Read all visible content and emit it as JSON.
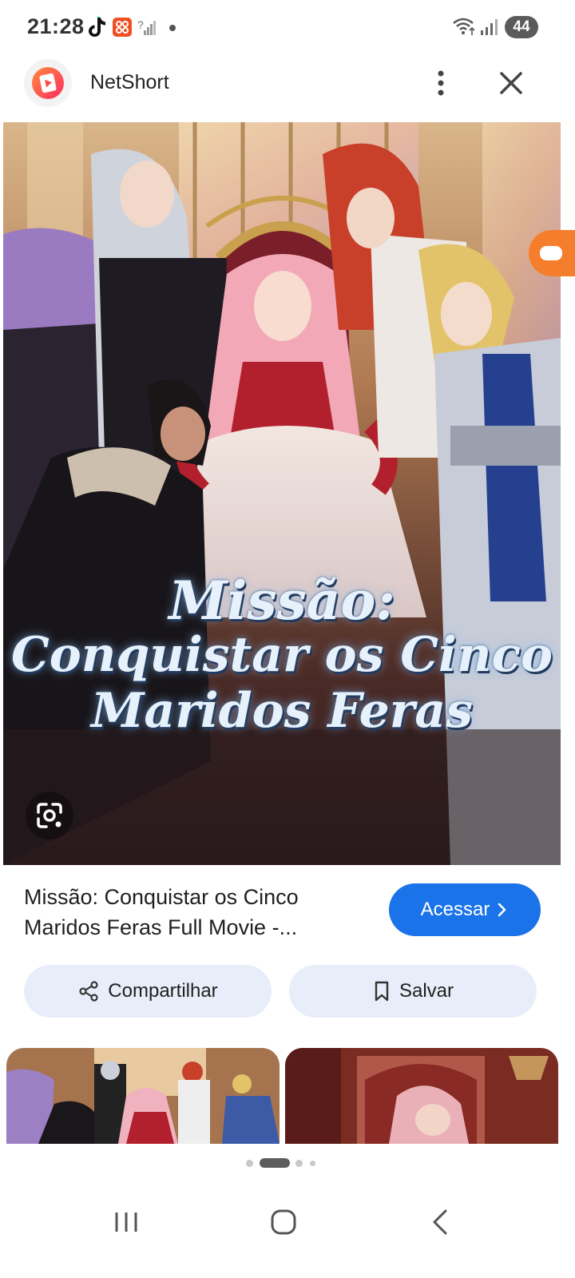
{
  "status_bar": {
    "time": "21:28",
    "battery": "44",
    "icons": [
      "tiktok-icon",
      "app-notification-icon",
      "no-sim-signal-icon",
      "wifi-icon",
      "signal-icon"
    ]
  },
  "app_bar": {
    "title": "NetShort",
    "logo_icon": "netshort-logo",
    "more_icon": "more-vert-icon",
    "close_icon": "close-icon"
  },
  "hero": {
    "cover_text_line1": "Missão:",
    "cover_text_line2": "Conquistar os Cinco",
    "cover_text_line3": "Maridos Feras",
    "lens_icon": "lens-search-icon"
  },
  "result": {
    "title_line1": "Missão: Conquistar os Cinco",
    "title_line2": "Maridos Feras Full Movie -...",
    "access_label": "Acessar",
    "share_label": "Compartilhar",
    "save_label": "Salvar"
  },
  "colors": {
    "accent": "#1a73e8",
    "pill_bg": "#e8eef9",
    "side_pill": "#f47e2b"
  },
  "navigation": {
    "recents_icon": "recents-icon",
    "home_icon": "home-icon",
    "back_icon": "back-icon"
  }
}
